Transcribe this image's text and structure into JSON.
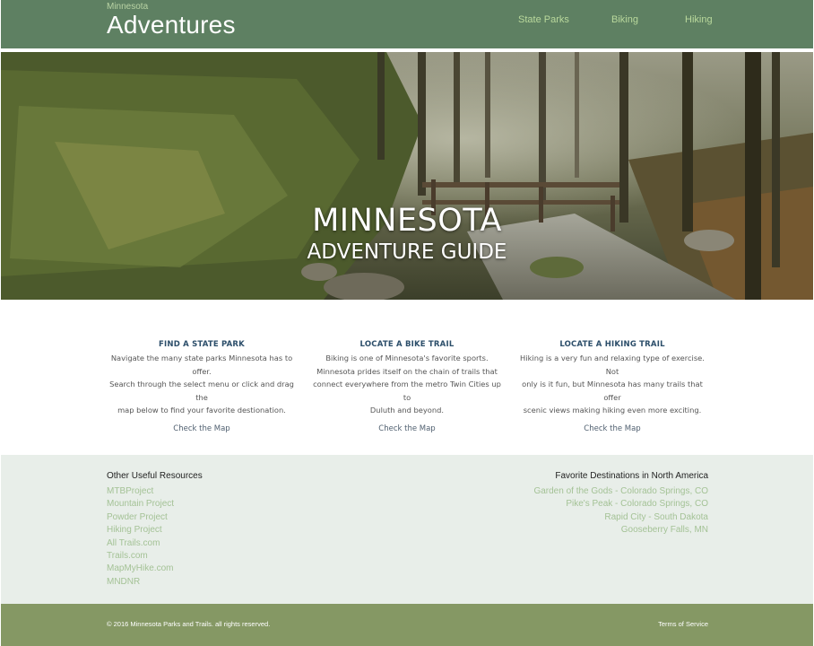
{
  "header": {
    "brand_sub": "Minnesota",
    "brand": "Adventures",
    "nav": [
      "State Parks",
      "Biking",
      "Hiking"
    ]
  },
  "hero": {
    "line1": "MINNESOTA",
    "line2": "ADVENTURE GUIDE",
    "image_description_hint": ""
  },
  "features": [
    {
      "title": "FIND A STATE PARK",
      "lines": [
        "Navigate the many state parks Minnesota has to offer.",
        "Search through the select menu or click and drag the",
        "map below to find your favorite destionation."
      ],
      "link": "Check the Map"
    },
    {
      "title": "LOCATE A BIKE TRAIL",
      "lines": [
        "Biking is one of Minnesota's favorite sports.",
        "Minnesota prides itself on the chain of trails that",
        "connect everywhere from the metro Twin Cities up to",
        "Duluth and beyond."
      ],
      "link": "Check the Map"
    },
    {
      "title": "LOCATE A HIKING TRAIL",
      "lines": [
        "Hiking is a very fun and relaxing type of exercise. Not",
        "only is it fun, but Minnesota has many trails that offer",
        "scenic views making hiking even more exciting."
      ],
      "link": "Check the Map"
    }
  ],
  "resources": {
    "left_title": "Other Useful Resources",
    "left_links": [
      "MTBProject",
      "Mountain Project",
      "Powder Project",
      "Hiking Project",
      "All Trails.com",
      "Trails.com",
      "MapMyHike.com",
      "MNDNR"
    ],
    "right_title": "Favorite Destinations in North America",
    "right_links": [
      "Garden of the Gods - Colorado Springs, CO",
      "Pike's Peak - Colorado Springs, CO",
      "Rapid City - South Dakota",
      "Gooseberry Falls, MN"
    ]
  },
  "footer": {
    "copyright": "© 2016 Minnesota Parks and Trails. all rights reserved.",
    "terms": "Terms of Service"
  },
  "colors": {
    "header_bg": "#5e8062",
    "nav_link": "#b9d89c",
    "feature_title": "#2c4e6a",
    "resources_bg": "#e8eee9",
    "resource_link": "#a4c296",
    "footer_bg": "#859864"
  }
}
